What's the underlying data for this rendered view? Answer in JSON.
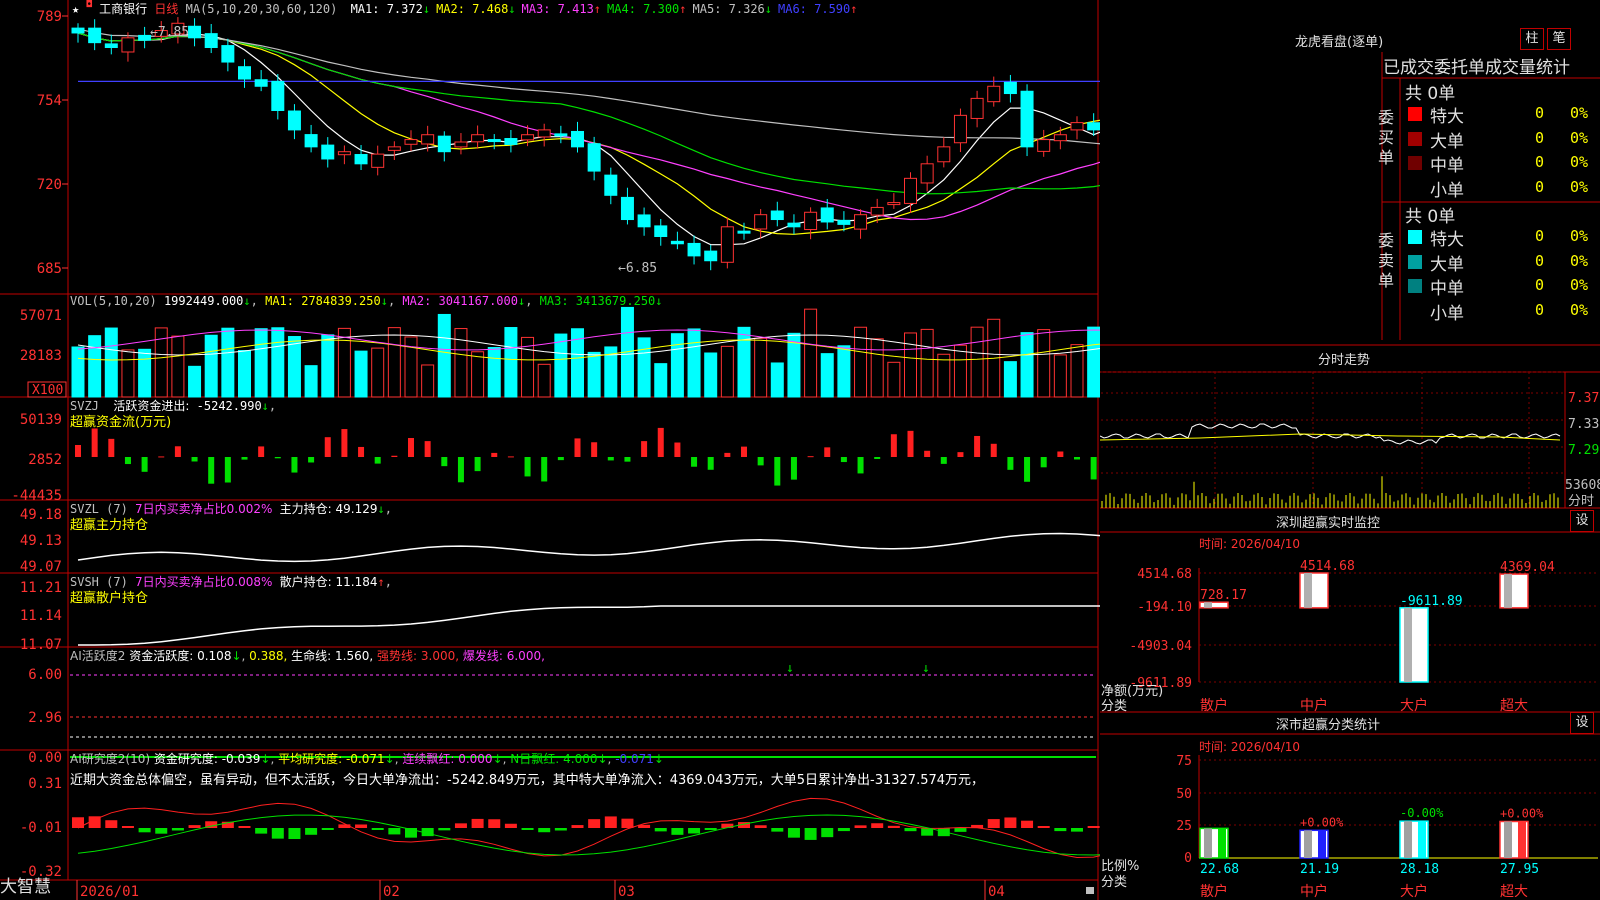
{
  "stock": {
    "name": "工商银行",
    "period": "日线",
    "star": "★"
  },
  "ma_header": {
    "prefix": "MA(5,10,20,30,60,120)",
    "items": [
      {
        "label": "MA1:",
        "value": "7.372",
        "arrow": "↓",
        "color": "#ffffff"
      },
      {
        "label": "MA2:",
        "value": "7.468",
        "arrow": "↓",
        "color": "#ffff00"
      },
      {
        "label": "MA3:",
        "value": "7.413",
        "arrow": "↑",
        "color": "#ff40ff"
      },
      {
        "label": "MA4:",
        "value": "7.300",
        "arrow": "↑",
        "color": "#00e000"
      },
      {
        "label": "MA5:",
        "value": "7.326",
        "arrow": "↓",
        "color": "#c0c0c0"
      },
      {
        "label": "MA6:",
        "value": "7.590",
        "arrow": "↑",
        "color": "#4040ff"
      }
    ]
  },
  "price_axis": [
    "789",
    "754",
    "720",
    "685"
  ],
  "price_marks": {
    "high": "7.85",
    "low": "←6.85"
  },
  "vol": {
    "prefix": "VOL(5,10,20)",
    "value": "1992449.000",
    "arrow": "↓",
    "ma1": "MA1: 2784839.250",
    "ma1_arrow": "↓",
    "ma2": "MA2: 3041167.000",
    "ma2_arrow": "↓",
    "ma3": "MA3: 3413679.250",
    "ma3_arrow": "↓",
    "axis": [
      "57071",
      "28183"
    ],
    "unit": "X100"
  },
  "svzj": {
    "name": "SVZJ",
    "label": "活跃资金进出:",
    "value": "-5242.990",
    "arrow": "↓",
    "subtitle": "超赢资金流(万元)",
    "axis": [
      "50139",
      "2852",
      "-44435"
    ]
  },
  "svzl": {
    "name": "SVZL (7)",
    "ratio": "7日内买卖净占比0.002%",
    "hold": "主力持仓: 49.129",
    "arrow": "↓",
    "subtitle": "超赢主力持仓",
    "axis": [
      "49.18",
      "49.13",
      "49.07"
    ]
  },
  "svsh": {
    "name": "SVSH (7)",
    "ratio": "7日内买卖净占比0.008%",
    "hold": "散户持仓: 11.184",
    "arrow": "↑",
    "subtitle": "超赢散户持仓",
    "axis": [
      "11.21",
      "11.14",
      "11.07"
    ]
  },
  "ai_active": {
    "name": "AI活跃度2",
    "label": "资金活跃度:",
    "v1": "0.108",
    "a1": "↓",
    "v2": "0.388,",
    "life": "生命线: 1.560,",
    "strong": "强势线: 3.000,",
    "burst": "爆发线: 6.000,",
    "axis": [
      "6.00",
      "2.96",
      "0.00"
    ]
  },
  "ai_research": {
    "name": "AI研究度2(10)",
    "r1": "资金研究度: -0.039",
    "r1a": "↓",
    "r2": "平均研究度: -0.071",
    "r2a": "↓",
    "r3": "连续飘红: 0.000",
    "r3a": "↓",
    "r4": "N日飘红: 4.000",
    "r4a": "↓",
    "r5": "-0.071",
    "r5a": "↓",
    "comment": "近期大资金总体偏空，虽有异动，但不太活跃，今日大单净流出：-5242.849万元，其中特大单净流入：4369.043万元，大单5日累计净出-31327.574万元，",
    "axis": [
      "0.31",
      "-0.01",
      "-0.32"
    ]
  },
  "date_axis": [
    "2026/01",
    "02",
    "03",
    "04"
  ],
  "brand": "大智慧",
  "lhb": {
    "title": "龙虎看盘(逐单)",
    "btn1": "柱",
    "btn2": "笔",
    "header": "已成交委托单成交量统计",
    "buy": {
      "side": "委买单",
      "total": "共 0单",
      "rows": [
        {
          "label": "特大",
          "value": "0",
          "pct": "0%",
          "color": "#ff0000"
        },
        {
          "label": "大单",
          "value": "0",
          "pct": "0%",
          "color": "#a00000"
        },
        {
          "label": "中单",
          "value": "0",
          "pct": "0%",
          "color": "#700000"
        },
        {
          "label": "小单",
          "value": "0",
          "pct": "0%",
          "color": "#000000"
        }
      ]
    },
    "sell": {
      "side": "委卖单",
      "total": "共 0单",
      "rows": [
        {
          "label": "特大",
          "value": "0",
          "pct": "0%",
          "color": "#00ffff"
        },
        {
          "label": "大单",
          "value": "0",
          "pct": "0%",
          "color": "#00a0a0"
        },
        {
          "label": "中单",
          "value": "0",
          "pct": "0%",
          "color": "#008080"
        },
        {
          "label": "小单",
          "value": "0",
          "pct": "0%",
          "color": "#000000"
        }
      ]
    }
  },
  "intraday": {
    "title": "分时走势",
    "axis": [
      "7.37",
      "7.33",
      "7.29"
    ],
    "vol_label": "53608",
    "vol_unit": "分时"
  },
  "sz_monitor": {
    "title": "深圳超赢实时监控",
    "btn": "设",
    "time": "时间: 2026/04/10",
    "axis": [
      "4514.68",
      "-194.10",
      "-4903.04",
      "-9611.89"
    ],
    "ylabel": "净额(万元)",
    "xlabel": "分类",
    "categories": [
      "散户",
      "中户",
      "大户",
      "超大"
    ],
    "values": [
      728.17,
      4514.68,
      -9611.89,
      4369.04
    ],
    "value_labels": [
      "728.17",
      "4514.68",
      "-9611.89",
      "4369.04"
    ]
  },
  "sz_class": {
    "title": "深市超赢分类统计",
    "btn": "设",
    "time": "时间: 2026/04/10",
    "axis": [
      "75",
      "50",
      "25",
      "0"
    ],
    "ylabel": "比例%",
    "xlabel": "分类",
    "categories": [
      "散户",
      "中户",
      "大户",
      "超大"
    ],
    "values": [
      22.68,
      21.19,
      28.18,
      27.95
    ],
    "value_labels": [
      "22.68",
      "21.19",
      "28.18",
      "27.95"
    ],
    "change_labels": [
      "",
      "+0.00%",
      "-0.00%",
      "+0.00%"
    ]
  },
  "chart_data": [
    {
      "type": "candlestick",
      "title": "工商银行 日线",
      "ylim": [
        6.8,
        7.95
      ],
      "x": [
        "2026/01",
        "02",
        "03",
        "04"
      ],
      "series": [
        {
          "name": "MA1",
          "last": 7.372
        },
        {
          "name": "MA2",
          "last": 7.468
        },
        {
          "name": "MA3",
          "last": 7.413
        },
        {
          "name": "MA4",
          "last": 7.3
        },
        {
          "name": "MA5",
          "last": 7.326
        },
        {
          "name": "MA6",
          "last": 7.59
        }
      ],
      "close": [
        7.82,
        7.78,
        7.76,
        7.8,
        7.79,
        7.83,
        7.86,
        7.8,
        7.76,
        7.7,
        7.63,
        7.6,
        7.5,
        7.42,
        7.35,
        7.3,
        7.33,
        7.28,
        7.32,
        7.35,
        7.38,
        7.4,
        7.33,
        7.37,
        7.4,
        7.38,
        7.36,
        7.4,
        7.42,
        7.4,
        7.35,
        7.25,
        7.15,
        7.05,
        7.02,
        6.98,
        6.95,
        6.9,
        6.88,
        7.02,
        7.0,
        7.07,
        7.05,
        7.02,
        7.08,
        7.04,
        7.03,
        7.07,
        7.1,
        7.12,
        7.22,
        7.28,
        7.35,
        7.48,
        7.55,
        7.6,
        7.57,
        7.35,
        7.38,
        7.4,
        7.45,
        7.42,
        7.48,
        7.55,
        7.65,
        7.72,
        7.75,
        7.7,
        7.62,
        7.52,
        7.46,
        7.4,
        7.36
      ]
    }
  ]
}
